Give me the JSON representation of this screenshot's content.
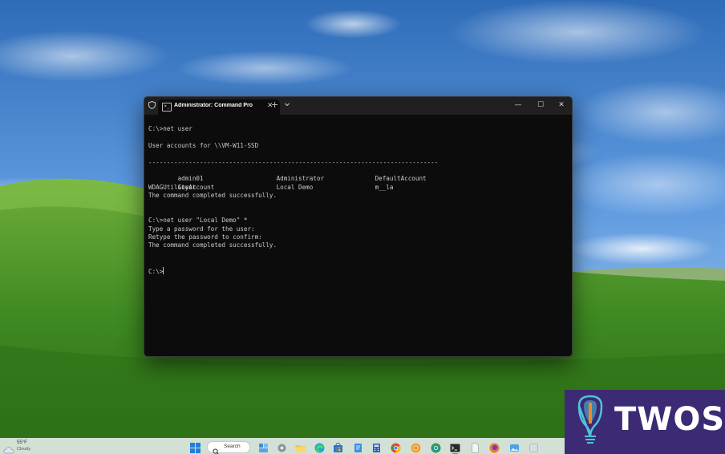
{
  "terminal": {
    "tab_title": "Administrator: Command Pro",
    "tab_icon_glyph": ">_",
    "lines": [
      "C:\\>net user",
      "",
      "User accounts for \\\\VM-W11-SSD",
      "",
      "-------------------------------------------------------------------------------",
      [
        "admin01",
        "Administrator",
        "DefaultAccount"
      ],
      [
        "Guest",
        "Local Demo",
        "m__la"
      ],
      "WDAGUtilityAccount",
      "The command completed successfully.",
      "",
      "",
      "C:\\>net user \"Local Demo\" *",
      "Type a password for the user:",
      "Retype the password to confirm:",
      "The command completed successfully.",
      "",
      "",
      "C:\\>"
    ],
    "row_admin01": [
      "admin01",
      "Administrator",
      "DefaultAccount"
    ],
    "row_guest": [
      "Guest",
      "Local Demo",
      "m__la"
    ]
  },
  "taskbar": {
    "weather_temp": "55°F",
    "weather_condition": "Cloudy",
    "search_label": "Search",
    "apps": [
      "windows-start-icon",
      "widgets-icon",
      "settings-icon",
      "file-explorer-icon",
      "edge-icon",
      "store-icon",
      "notepad-icon",
      "calculator-icon",
      "chrome-icon",
      "chrome-dev-icon",
      "terminal-icon",
      "document-icon",
      "firefox-icon",
      "app-icon"
    ]
  },
  "watermark": {
    "text": "TWOS",
    "colors": {
      "background": "#3d2a74",
      "accent": "#4fc3d8",
      "orange": "#f08a24"
    }
  },
  "colors": {
    "terminal_bg": "#0c0c0c",
    "titlebar_bg": "#202020",
    "terminal_text": "#cccccc"
  }
}
